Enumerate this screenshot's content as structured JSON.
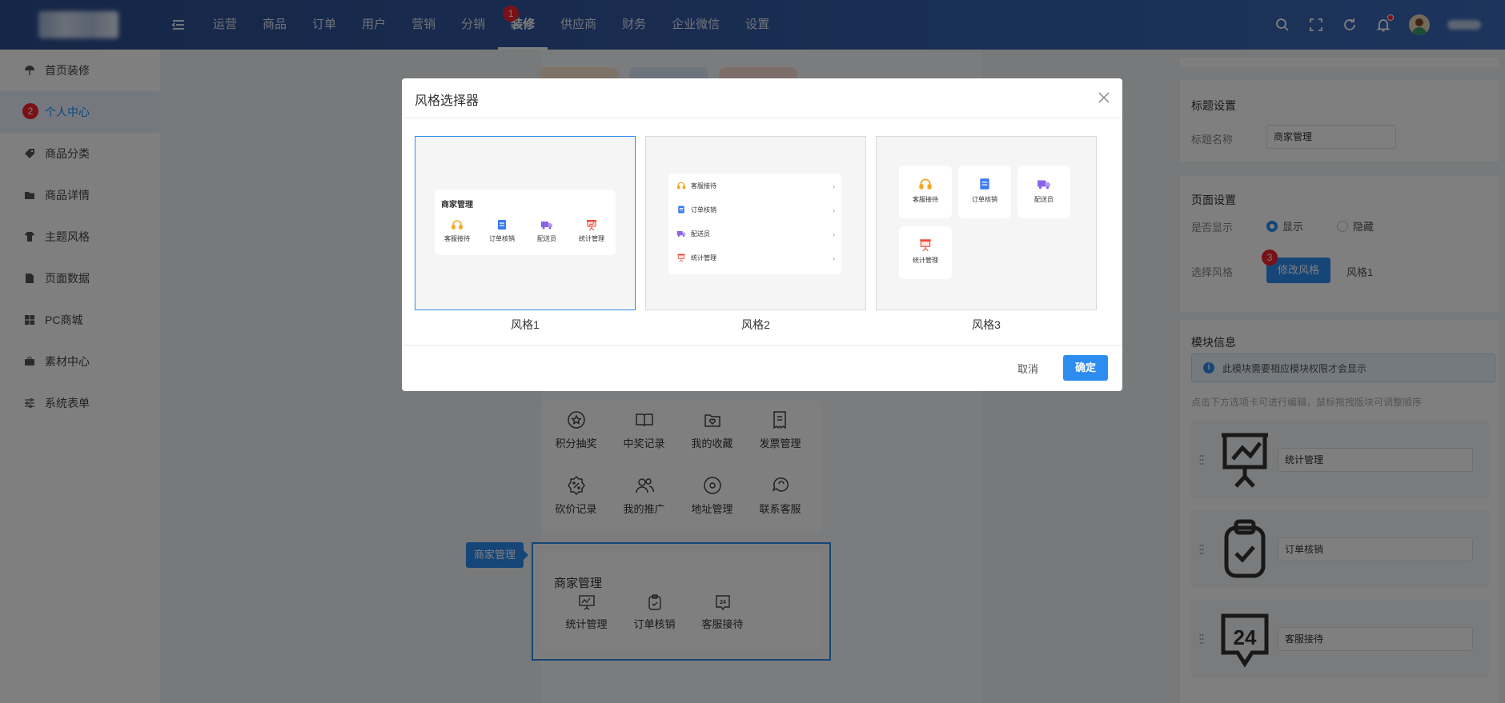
{
  "header": {
    "nav": [
      {
        "label": "运营"
      },
      {
        "label": "商品"
      },
      {
        "label": "订单"
      },
      {
        "label": "用户"
      },
      {
        "label": "营销"
      },
      {
        "label": "分销"
      },
      {
        "label": "装修",
        "badge": "1"
      },
      {
        "label": "供应商"
      },
      {
        "label": "财务"
      },
      {
        "label": "企业微信"
      },
      {
        "label": "设置"
      }
    ],
    "accent": "#2c4d8f"
  },
  "sidebar": {
    "items": [
      {
        "label": "首页装修",
        "icon": "umbrella-icon"
      },
      {
        "label": "个人中心",
        "icon": "user-icon",
        "badge": "2"
      },
      {
        "label": "商品分类",
        "icon": "tag-icon"
      },
      {
        "label": "商品详情",
        "icon": "folder-icon"
      },
      {
        "label": "主题风格",
        "icon": "shirt-icon"
      },
      {
        "label": "页面数据",
        "icon": "page-icon"
      },
      {
        "label": "PC商城",
        "icon": "windows-icon"
      },
      {
        "label": "素材中心",
        "icon": "briefcase-icon"
      },
      {
        "label": "系统表单",
        "icon": "sliders-icon"
      }
    ]
  },
  "preview": {
    "grid": [
      {
        "label": "积分抽奖",
        "icon": "prize-icon"
      },
      {
        "label": "中奖记录",
        "icon": "book-icon"
      },
      {
        "label": "我的收藏",
        "icon": "favorite-icon"
      },
      {
        "label": "发票管理",
        "icon": "invoice-icon"
      },
      {
        "label": "砍价记录",
        "icon": "bargain-icon"
      },
      {
        "label": "我的推广",
        "icon": "promote-icon"
      },
      {
        "label": "地址管理",
        "icon": "location-icon"
      },
      {
        "label": "联系客服",
        "icon": "chat-icon"
      }
    ],
    "selected_label": "商家管理",
    "merchant": {
      "title": "商家管理",
      "items": [
        {
          "label": "统计管理",
          "icon": "stats-icon"
        },
        {
          "label": "订单核销",
          "icon": "clipboard-check-icon"
        },
        {
          "label": "客服接待",
          "icon": "service-24-icon"
        }
      ]
    }
  },
  "right": {
    "title_section": {
      "heading": "标题设置",
      "name_label": "标题名称",
      "name_value": "商家管理"
    },
    "page_section": {
      "heading": "页面设置",
      "show_label": "是否显示",
      "show_option": "显示",
      "hide_option": "隐藏",
      "style_label": "选择风格",
      "modify_button": "修改风格",
      "modify_badge": "3",
      "current_style": "风格1"
    },
    "module_section": {
      "heading": "模块信息",
      "notice": "此模块需要相应模块权限才会显示",
      "hint": "点击下方选项卡可进行编辑，鼠标拖拽版块可调整顺序",
      "modules": [
        {
          "value": "统计管理",
          "icon": "stats-icon"
        },
        {
          "value": "订单核销",
          "icon": "clipboard-check-icon"
        },
        {
          "value": "客服接待",
          "icon": "service-24-icon"
        }
      ]
    }
  },
  "modal": {
    "title": "风格选择器",
    "styles": [
      {
        "name": "风格1",
        "card_title": "商家管理",
        "items": [
          "客服接待",
          "订单核销",
          "配送员",
          "统计管理"
        ]
      },
      {
        "name": "风格2",
        "items": [
          "客服接待",
          "订单核销",
          "配送员",
          "统计管理"
        ]
      },
      {
        "name": "风格3",
        "items": [
          "客服接待",
          "订单核销",
          "配送员",
          "统计管理"
        ]
      }
    ],
    "cancel": "取消",
    "ok": "确定"
  }
}
